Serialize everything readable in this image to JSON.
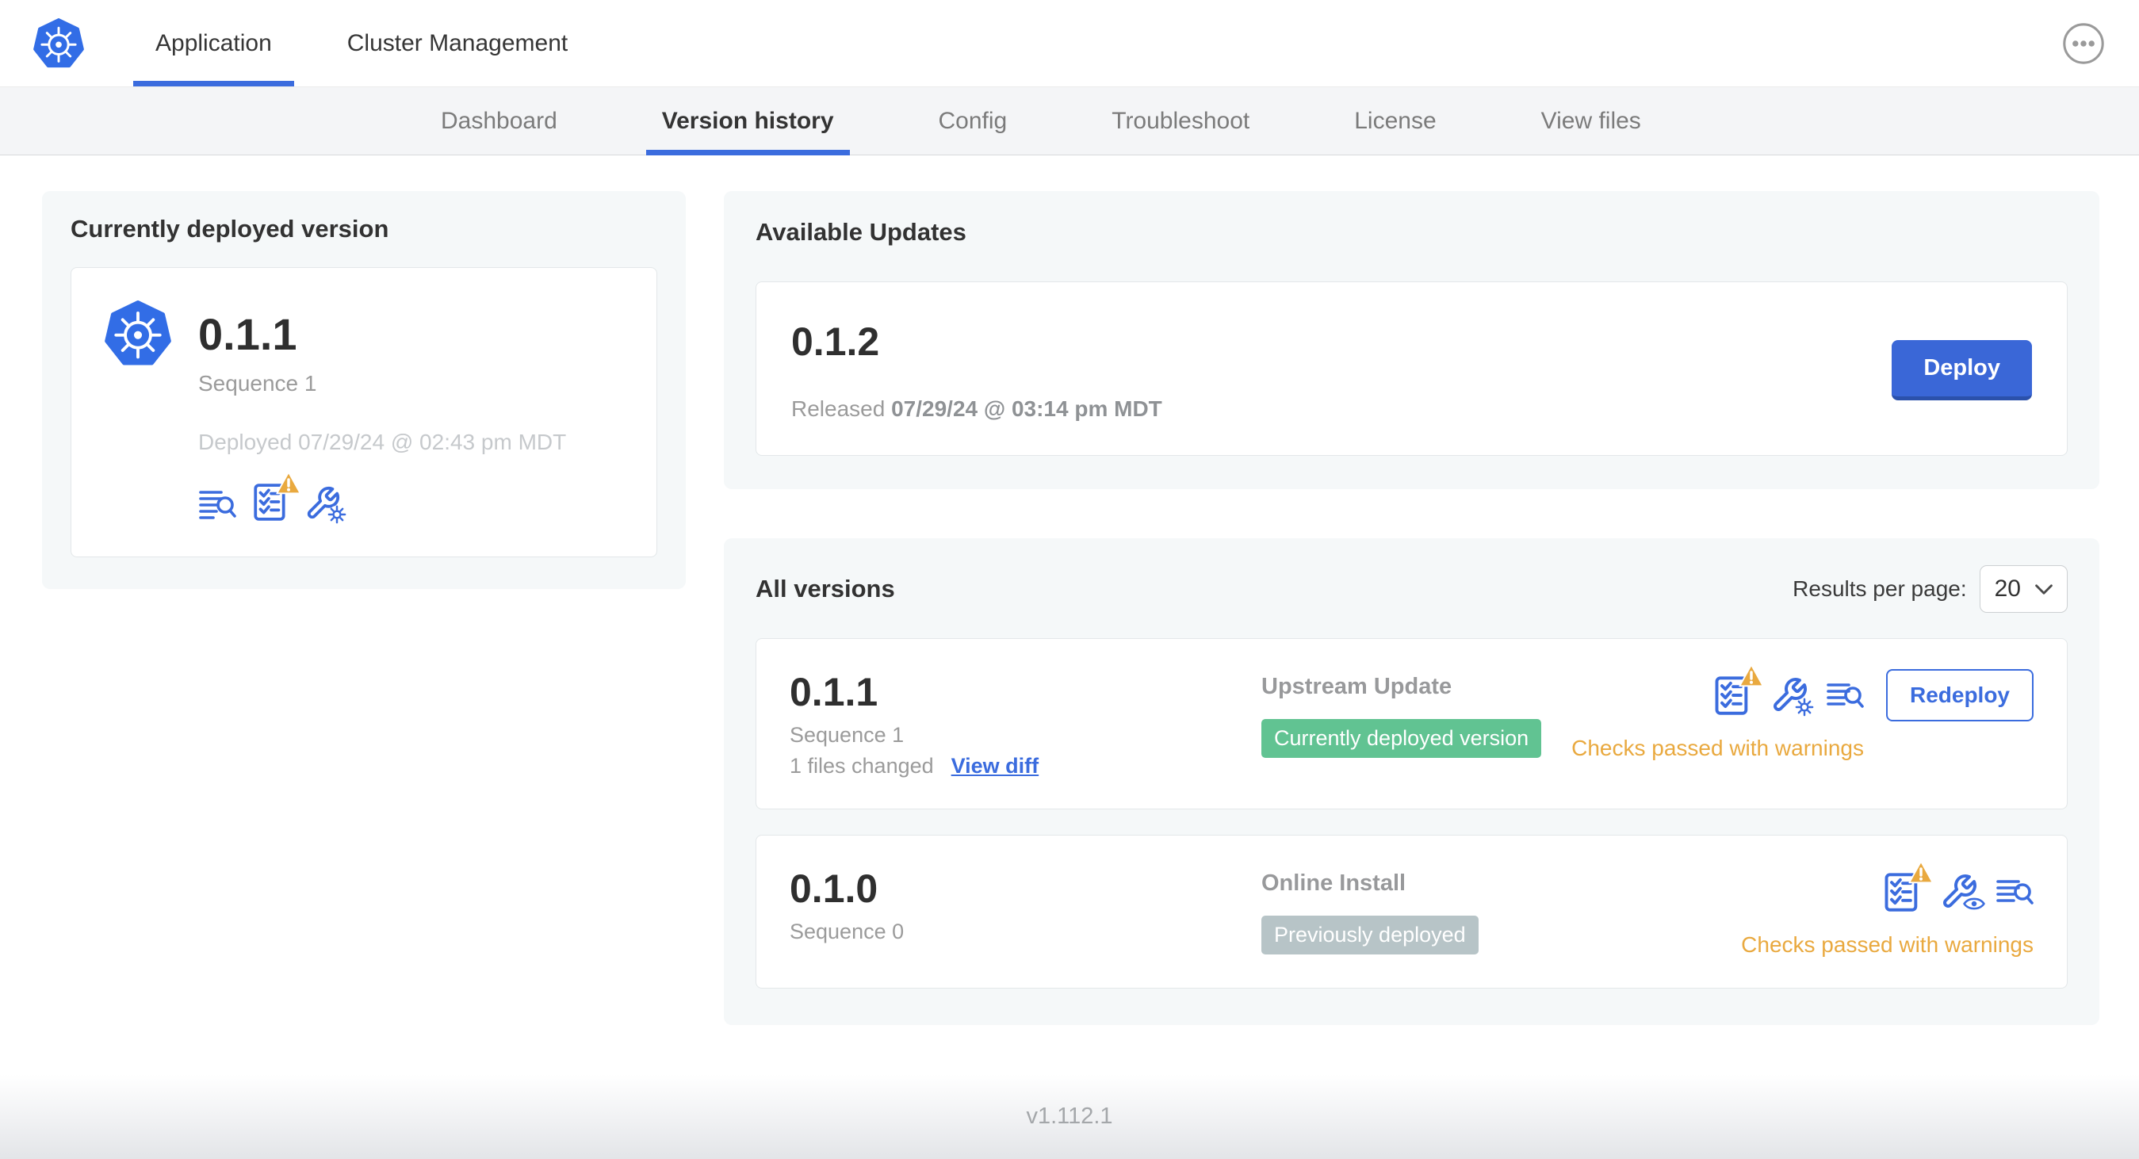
{
  "topnav": {
    "tabs": [
      {
        "label": "Application",
        "active": true
      },
      {
        "label": "Cluster Management",
        "active": false
      }
    ]
  },
  "subnav": {
    "items": [
      {
        "label": "Dashboard",
        "active": false
      },
      {
        "label": "Version history",
        "active": true
      },
      {
        "label": "Config",
        "active": false
      },
      {
        "label": "Troubleshoot",
        "active": false
      },
      {
        "label": "License",
        "active": false
      },
      {
        "label": "View files",
        "active": false
      }
    ]
  },
  "currently_deployed": {
    "title": "Currently deployed version",
    "version": "0.1.1",
    "sequence": "Sequence 1",
    "deployed_at": "Deployed 07/29/24 @ 02:43 pm MDT",
    "icons": [
      "view-logs-icon",
      "preflight-checks-warning-icon",
      "edit-config-icon"
    ]
  },
  "available_updates": {
    "title": "Available Updates",
    "version": "0.1.2",
    "released_label": "Released",
    "released_date": "07/29/24 @ 03:14 pm MDT",
    "deploy_label": "Deploy"
  },
  "all_versions": {
    "title": "All versions",
    "results_per_page_label": "Results per page:",
    "results_per_page_value": "20",
    "rows": [
      {
        "version": "0.1.1",
        "sequence": "Sequence 1",
        "files_changed": "1 files changed",
        "view_diff_label": "View diff",
        "source": "Upstream Update",
        "badge": "Currently deployed version",
        "badge_type": "green",
        "status": "Checks passed with warnings",
        "action_label": "Redeploy",
        "icons": [
          "preflight-checks-warning-icon",
          "edit-config-icon",
          "view-logs-icon"
        ]
      },
      {
        "version": "0.1.0",
        "sequence": "Sequence 0",
        "source": "Online Install",
        "badge": "Previously deployed",
        "badge_type": "gray",
        "status": "Checks passed with warnings",
        "icons": [
          "preflight-checks-warning-icon",
          "view-config-icon",
          "view-logs-icon"
        ]
      }
    ]
  },
  "footer": {
    "version_label": "v1.112.1"
  },
  "colors": {
    "accent_blue": "#3b6cde",
    "k8s_blue": "#326de6",
    "badge_green": "#61c392",
    "badge_gray": "#b7c4c7",
    "warning_amber": "#e9a93f"
  }
}
